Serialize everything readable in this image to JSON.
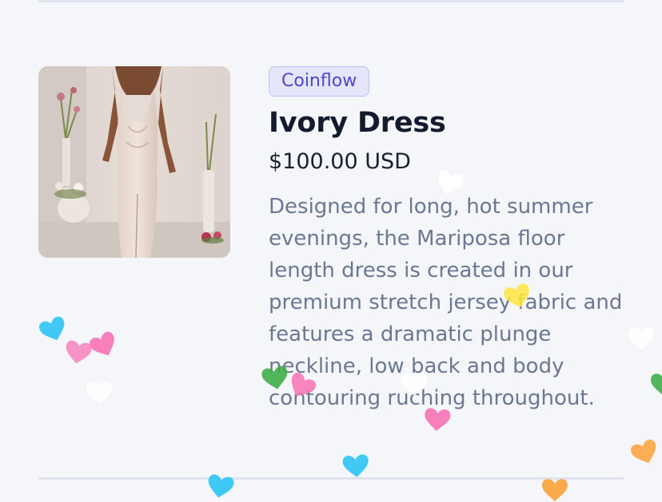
{
  "product": {
    "image_alt": "Woman wearing an ivory halter floor-length dress",
    "merchant_badge": "Coinflow",
    "title": "Ivory Dress",
    "price": "$100.00 USD",
    "description": "Designed for long, hot summer evenings, the Mariposa floor length dress is created in our premium stretch jersey fabric and features a dramatic plunge neckline, low back and body contouring ruching throughout."
  },
  "confetti": {
    "shape": "heart-icon",
    "colors": [
      "#2ec4f5",
      "#f772b4",
      "#ffffff",
      "#3fae49",
      "#ffe53b",
      "#fca13a"
    ]
  }
}
